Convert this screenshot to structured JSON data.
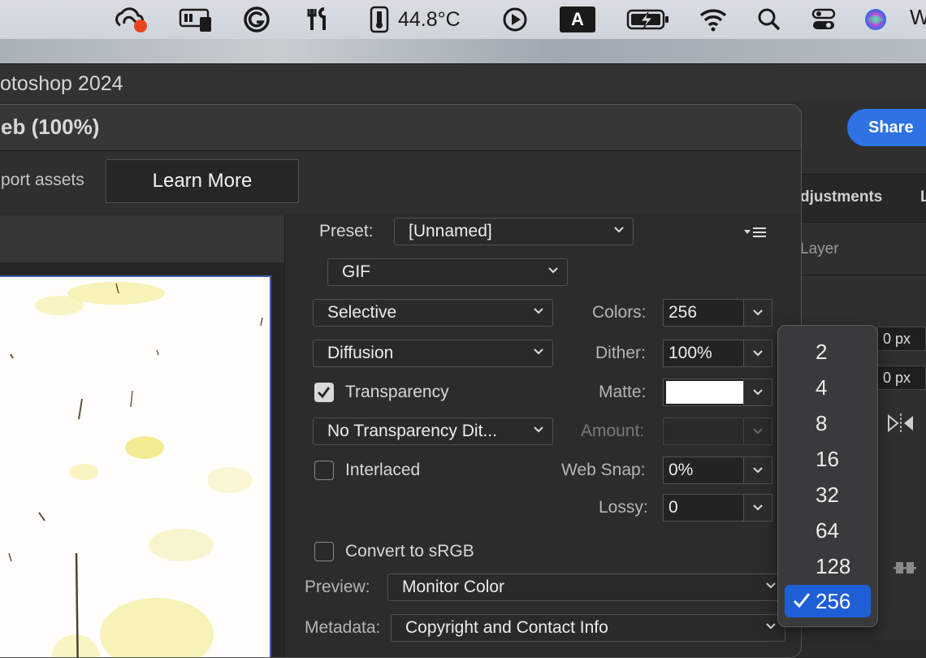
{
  "menubar": {
    "temperature": "44.8°C",
    "input_letter": "A",
    "trailing_letter": "W"
  },
  "app": {
    "title": "otoshop 2024"
  },
  "ps_right": {
    "share_label": "Share",
    "tab_adjustments": "djustments",
    "tab_next": "L",
    "layer_label": "Layer",
    "px_field_1": "0 px",
    "px_field_2": "0 px"
  },
  "dialog": {
    "title": "eb (100%)",
    "export_assets": "port assets",
    "learn_more": "Learn More",
    "preset_label": "Preset:",
    "preset_value": "[Unnamed]",
    "format_value": "GIF",
    "reduction_value": "Selective",
    "dither_algo_value": "Diffusion",
    "transparency_label": "Transparency",
    "transparency_checked": true,
    "transparency_dither_value": "No Transparency Dit...",
    "interlaced_label": "Interlaced",
    "interlaced_checked": false,
    "colors_label": "Colors:",
    "colors_value": "256",
    "dither_label": "Dither:",
    "dither_value": "100%",
    "matte_label": "Matte:",
    "matte_color": "#ffffff",
    "amount_label": "Amount:",
    "websnap_label": "Web Snap:",
    "websnap_value": "0%",
    "lossy_label": "Lossy:",
    "lossy_value": "0",
    "convert_label": "Convert to sRGB",
    "convert_checked": false,
    "preview_label": "Preview:",
    "preview_value": "Monitor Color",
    "metadata_label": "Metadata:",
    "metadata_value": "Copyright and Contact Info"
  },
  "colors_popup": {
    "options": [
      "2",
      "4",
      "8",
      "16",
      "32",
      "64",
      "128",
      "256"
    ],
    "selected": "256"
  },
  "accent_colors": {
    "share_button": "#2f72e3",
    "popup_selected": "#1f5fd6",
    "image_border": "#3c5ea9"
  }
}
